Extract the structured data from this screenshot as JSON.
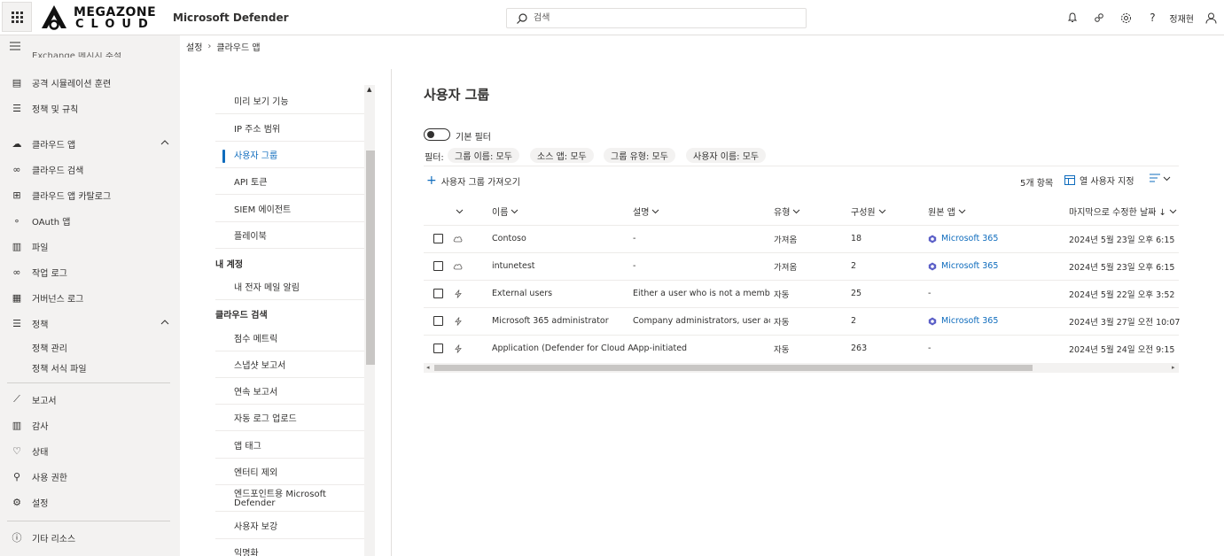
{
  "header": {
    "logo_line1": "MEGAZONE",
    "logo_line2": "CLOUD",
    "app_title": "Microsoft Defender",
    "search_placeholder": "검색",
    "user_name": "정재현"
  },
  "nav": {
    "partial_item": "Exchange 메시지 추적",
    "items": [
      {
        "label": "공격 시뮬레이션 훈련",
        "icon": "simulation-icon"
      },
      {
        "label": "정책 및 규칙",
        "icon": "policy-icon"
      },
      {
        "label": "클라우드 앱",
        "icon": "cloud-icon",
        "expanded": true
      },
      {
        "label": "클라우드 검색",
        "icon": "binoculars-icon"
      },
      {
        "label": "클라우드 앱 카탈로그",
        "icon": "catalog-icon"
      },
      {
        "label": "OAuth 앱",
        "icon": "oauth-icon"
      },
      {
        "label": "파일",
        "icon": "file-icon"
      },
      {
        "label": "작업 로그",
        "icon": "glasses-icon"
      },
      {
        "label": "거버넌스 로그",
        "icon": "clipboard-icon"
      },
      {
        "label": "정책",
        "icon": "policy-icon",
        "expanded": true
      },
      {
        "label": "보고서",
        "icon": "chart-icon"
      },
      {
        "label": "감사",
        "icon": "audit-icon"
      },
      {
        "label": "상태",
        "icon": "heart-icon"
      },
      {
        "label": "사용 권한",
        "icon": "key-icon"
      },
      {
        "label": "설정",
        "icon": "gear-icon"
      },
      {
        "label": "기타 리소스",
        "icon": "info-icon"
      }
    ],
    "policy_sub": [
      "정책 관리",
      "정책 서식 파일"
    ]
  },
  "breadcrumb": [
    "설정",
    "클라우드 앱"
  ],
  "settings_list": {
    "items_a": [
      "미리 보기 기능",
      "IP 주소 범위",
      "사용자 그룹",
      "API 토큰",
      "SIEM 에이전트",
      "플레이북"
    ],
    "head_my_account": "내 계정",
    "items_b": [
      "내 전자 메일 알림"
    ],
    "head_cloud_discovery": "클라우드 검색",
    "items_c": [
      "점수 메트릭",
      "스냅샷 보고서",
      "연속 보고서",
      "자동 로그 업로드",
      "앱 태그",
      "엔터티 제외",
      "엔드포인트용 Microsoft Defender",
      "사용자 보강",
      "익명화"
    ],
    "active": "사용자 그룹"
  },
  "main": {
    "title": "사용자 그룹",
    "toggle_label": "기본 필터",
    "filter_label": "필터:",
    "chips": [
      "그룹 이름: 모두",
      "소스 앱: 모두",
      "그룹 유형: 모두",
      "사용자 이름: 모두"
    ],
    "import_label": "사용자 그룹 가져오기",
    "count": "5개 항목",
    "customize_label": "열 사용자 지정"
  },
  "table": {
    "columns": [
      "이름",
      "설명",
      "유형",
      "구성원",
      "원본 앱",
      "마지막으로 수정한 날짜 ↓"
    ],
    "rows": [
      {
        "icon": "cloud-icon",
        "name": "Contoso",
        "desc": "-",
        "type": "가져옴",
        "members": "18",
        "app": "Microsoft 365",
        "date": "2024년 5월 23일 오후 6:15"
      },
      {
        "icon": "cloud-icon",
        "name": "intunetest",
        "desc": "-",
        "type": "가져옴",
        "members": "2",
        "app": "Microsoft 365",
        "date": "2024년 5월 23일 오후 6:15"
      },
      {
        "icon": "lightning-icon",
        "name": "External users",
        "desc": "Either a user who is not a member o...",
        "type": "자동",
        "members": "25",
        "app": "-",
        "date": "2024년 5월 22일 오후 3:52"
      },
      {
        "icon": "lightning-icon",
        "name": "Microsoft 365 administrator",
        "desc": "Company administrators, user accou...",
        "type": "자동",
        "members": "2",
        "app": "Microsoft 365",
        "date": "2024년 3월 27일 오전 10:07"
      },
      {
        "icon": "lightning-icon",
        "name": "Application (Defender for Cloud Apps)",
        "desc": "App-initiated",
        "type": "자동",
        "members": "263",
        "app": "-",
        "date": "2024년 5월 24일 오전 9:15"
      }
    ]
  },
  "colors": {
    "accent": "#0f6cbd",
    "nav_bg": "#f3f2f1",
    "chip_bg": "#f3f2f1"
  }
}
